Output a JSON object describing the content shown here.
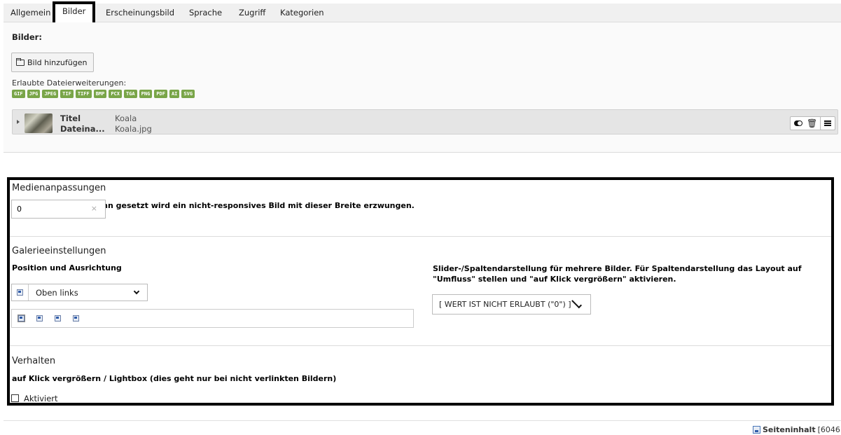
{
  "tabs": [
    "Allgemein",
    "Bilder",
    "Erscheinungsbild",
    "Sprache",
    "Zugriff",
    "Kategorien"
  ],
  "active_tab": "Bilder",
  "images": {
    "heading": "Bilder:",
    "add_button": "Bild hinzufügen",
    "allowed_label": "Erlaubte Dateierweiterungen:",
    "extensions": [
      "GIF",
      "JPG",
      "JPEG",
      "TIF",
      "TIFF",
      "BMP",
      "PCX",
      "TGA",
      "PNG",
      "PDF",
      "AI",
      "SVG"
    ],
    "file": {
      "title_key": "Titel",
      "title_value": "Koala",
      "filename_key": "Dateina...",
      "filename_value": "Koala.jpg"
    }
  },
  "media": {
    "title": "Medienanpassungen",
    "width_label": "'0' = Responsive. Wenn gesetzt wird ein nicht-responsives Bild mit dieser Breite erzwungen.",
    "width_value": "0",
    "clear_symbol": "×"
  },
  "gallery": {
    "title": "Galerieeinstellungen",
    "position_label": "Position und Ausrichtung",
    "position_value": "Oben links",
    "slider_label": "Slider-/Spaltendarstellung für mehrere Bilder. Für Spaltendarstellung das Layout auf \"Umfluss\" stellen und \"auf Klick vergrößern\" aktivieren.",
    "slider_value": "[ WERT IST NICHT ERLAUBT (\"0\") ]"
  },
  "behaviour": {
    "title": "Verhalten",
    "lightbox_label": "auf Klick vergrößern / Lightbox (dies geht nur bei nicht verlinkten Bildern)",
    "checkbox_label": "Aktiviert",
    "checked": false
  },
  "footer": {
    "record_label": "Seiteninhalt",
    "record_id": "[6046"
  }
}
